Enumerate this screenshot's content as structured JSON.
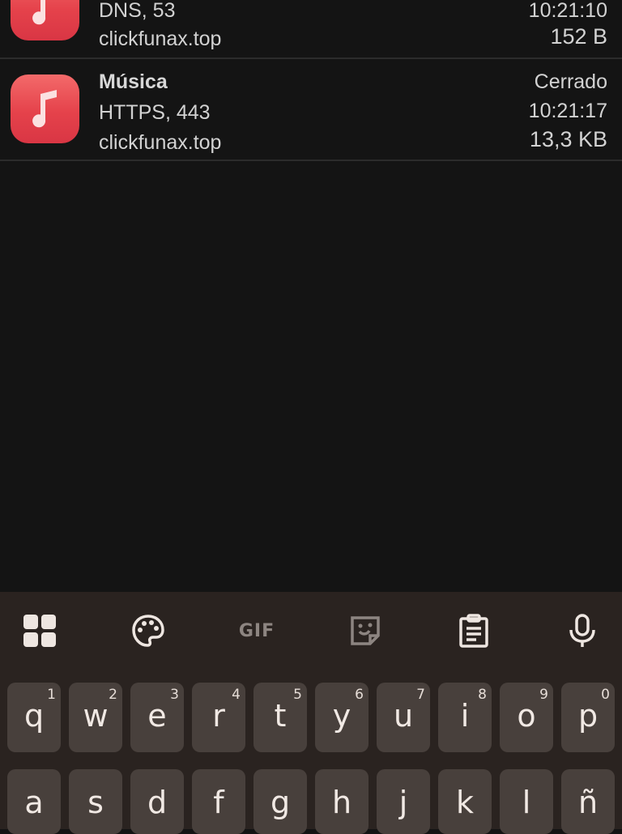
{
  "connections": [
    {
      "app": "",
      "protocol": "DNS, 53",
      "host": "clickfunax.top",
      "status": "",
      "time": "10:21:10",
      "size": "152 B"
    },
    {
      "app": "Música",
      "protocol": "HTTPS, 443",
      "host": "clickfunax.top",
      "status": "Cerrado",
      "time": "10:21:17",
      "size": "13,3 KB"
    }
  ],
  "keyboard": {
    "toolbar": [
      "apps-grid-icon",
      "palette-icon",
      "gif-icon",
      "sticker-icon",
      "clipboard-icon",
      "mic-icon"
    ],
    "gif_label": "GIF",
    "row1": [
      {
        "key": "q",
        "num": "1"
      },
      {
        "key": "w",
        "num": "2"
      },
      {
        "key": "e",
        "num": "3"
      },
      {
        "key": "r",
        "num": "4"
      },
      {
        "key": "t",
        "num": "5"
      },
      {
        "key": "y",
        "num": "6"
      },
      {
        "key": "u",
        "num": "7"
      },
      {
        "key": "i",
        "num": "8"
      },
      {
        "key": "o",
        "num": "9"
      },
      {
        "key": "p",
        "num": "0"
      }
    ],
    "row2": [
      "a",
      "s",
      "d",
      "f",
      "g",
      "h",
      "j",
      "k",
      "l",
      "ñ"
    ]
  },
  "colors": {
    "background": "#141414",
    "keyboard": "#2a2320",
    "key": "#48403c",
    "app_icon": "#e5424b"
  }
}
